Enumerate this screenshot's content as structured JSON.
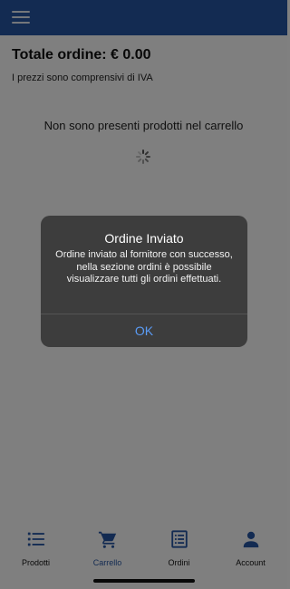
{
  "header": {
    "menu_icon": "hamburger-menu-icon",
    "color": "#2756a4"
  },
  "cart": {
    "total_label": "Totale ordine: € 0.00",
    "vat_note": "I prezzi sono comprensivi di IVA",
    "empty_message": "Non sono presenti prodotti nel carrello",
    "loading_icon": "spinner-icon"
  },
  "tabbar": {
    "tabs": [
      {
        "label": "Prodotti",
        "icon": "list-icon"
      },
      {
        "label": "Carrello",
        "icon": "cart-icon",
        "active": true
      },
      {
        "label": "Ordini",
        "icon": "orders-icon"
      },
      {
        "label": "Account",
        "icon": "person-icon"
      }
    ],
    "active_color": "#2756a4"
  },
  "dialog": {
    "title": "Ordine Inviato",
    "message": "Ordine inviato al fornitore con successo, nella sezione ordini è possibile visualizzare tutti gli ordini effettuati.",
    "ok_label": "OK",
    "ok_color": "#5a9bf5"
  }
}
